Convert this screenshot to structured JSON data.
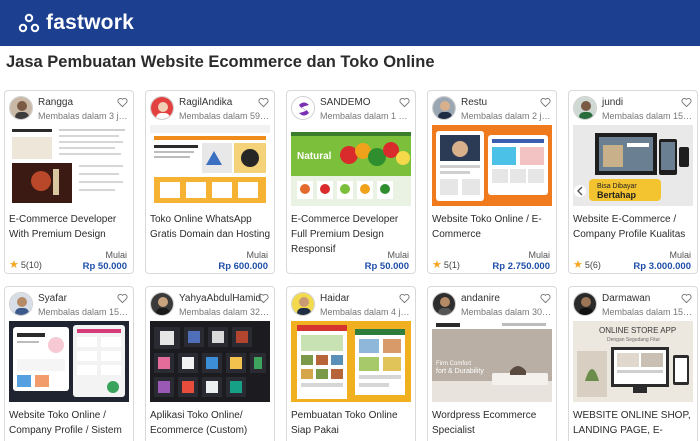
{
  "header": {
    "brand": "fastwork"
  },
  "page": {
    "title": "Jasa Pembuatan Website Ecommerce dan Toko Online"
  },
  "price_prefix": "Mulai",
  "cards": [
    {
      "seller": "Rangga",
      "status": "Membalas dalam 3 jam",
      "title": "E-Commerce Developer With Premium Design",
      "price": "Rp 50.000",
      "rating": "5(10)"
    },
    {
      "seller": "RagilAndika",
      "status": "Membalas dalam 59 me...",
      "title": "Toko Online WhatsApp Gratis Domain dan Hosting",
      "price": "Rp 600.000",
      "rating": ""
    },
    {
      "seller": "SANDEMO",
      "status": "Membalas dalam 1 menit",
      "title": "E-Commerce Developer Full Premium Design Responsif",
      "price": "Rp 50.000",
      "rating": ""
    },
    {
      "seller": "Restu",
      "status": "Membalas dalam 2 jam",
      "title": "Website Toko Online / E-Commerce",
      "price": "Rp 2.750.000",
      "rating": "5(1)"
    },
    {
      "seller": "jundi",
      "status": "Membalas dalam 15 me...",
      "title": "Website E-Commerce / Company Profile Kualitas",
      "price": "Rp 3.000.000",
      "rating": "5(6)"
    },
    {
      "seller": "Syafar",
      "status": "Membalas dalam 15 me...",
      "title": "Website Toko Online / Company Profile / Sistem",
      "price": "",
      "rating": ""
    },
    {
      "seller": "YahyaAbdulHamid",
      "status": "Membalas dalam 32 me...",
      "title": "Aplikasi Toko Online/ Ecommerce (Custom)",
      "price": "",
      "rating": ""
    },
    {
      "seller": "Haidar",
      "status": "Membalas dalam 4 jam",
      "title": "Pembuatan Toko Online Siap Pakai",
      "price": "",
      "rating": ""
    },
    {
      "seller": "andanire",
      "status": "Membalas dalam 30 me...",
      "title": "Wordpress Ecommerce Specialist",
      "price": "",
      "rating": ""
    },
    {
      "seller": "Darmawan",
      "status": "Membalas dalam 15 me...",
      "title": "WEBSITE ONLINE SHOP, LANDING PAGE, E-",
      "price": "",
      "rating": ""
    }
  ],
  "thumb_text": {
    "sandemo_logo": "SANDEMO",
    "natural": "Natural",
    "bisa_dibayar": "Bisa Dibayar",
    "bertahap": "Bertahap",
    "online_store": "ONLINE STORE APP",
    "online_store_sub": "Dengan Segudang Fitur",
    "comfort": "Firm Comfort",
    "durability": "fort & Durability"
  },
  "colors": {
    "brand": "#1c3f8f",
    "price": "#1f4fa8",
    "star": "#f5a623"
  }
}
